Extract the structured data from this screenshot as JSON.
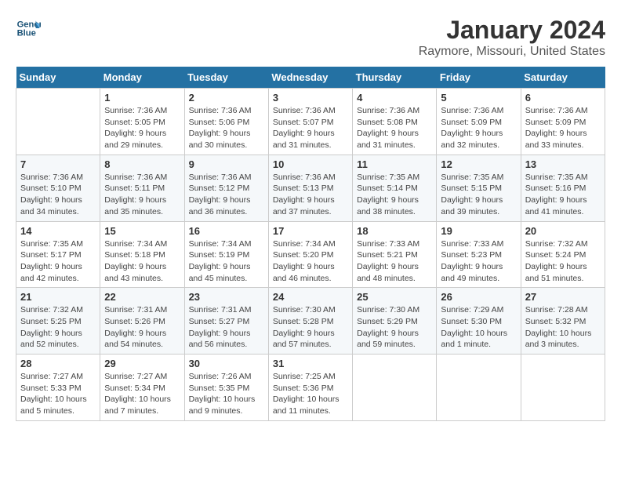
{
  "logo": {
    "line1": "General",
    "line2": "Blue"
  },
  "title": "January 2024",
  "subtitle": "Raymore, Missouri, United States",
  "days_of_week": [
    "Sunday",
    "Monday",
    "Tuesday",
    "Wednesday",
    "Thursday",
    "Friday",
    "Saturday"
  ],
  "weeks": [
    [
      {
        "day": "",
        "info": ""
      },
      {
        "day": "1",
        "info": "Sunrise: 7:36 AM\nSunset: 5:05 PM\nDaylight: 9 hours\nand 29 minutes."
      },
      {
        "day": "2",
        "info": "Sunrise: 7:36 AM\nSunset: 5:06 PM\nDaylight: 9 hours\nand 30 minutes."
      },
      {
        "day": "3",
        "info": "Sunrise: 7:36 AM\nSunset: 5:07 PM\nDaylight: 9 hours\nand 31 minutes."
      },
      {
        "day": "4",
        "info": "Sunrise: 7:36 AM\nSunset: 5:08 PM\nDaylight: 9 hours\nand 31 minutes."
      },
      {
        "day": "5",
        "info": "Sunrise: 7:36 AM\nSunset: 5:09 PM\nDaylight: 9 hours\nand 32 minutes."
      },
      {
        "day": "6",
        "info": "Sunrise: 7:36 AM\nSunset: 5:09 PM\nDaylight: 9 hours\nand 33 minutes."
      }
    ],
    [
      {
        "day": "7",
        "info": "Sunrise: 7:36 AM\nSunset: 5:10 PM\nDaylight: 9 hours\nand 34 minutes."
      },
      {
        "day": "8",
        "info": "Sunrise: 7:36 AM\nSunset: 5:11 PM\nDaylight: 9 hours\nand 35 minutes."
      },
      {
        "day": "9",
        "info": "Sunrise: 7:36 AM\nSunset: 5:12 PM\nDaylight: 9 hours\nand 36 minutes."
      },
      {
        "day": "10",
        "info": "Sunrise: 7:36 AM\nSunset: 5:13 PM\nDaylight: 9 hours\nand 37 minutes."
      },
      {
        "day": "11",
        "info": "Sunrise: 7:35 AM\nSunset: 5:14 PM\nDaylight: 9 hours\nand 38 minutes."
      },
      {
        "day": "12",
        "info": "Sunrise: 7:35 AM\nSunset: 5:15 PM\nDaylight: 9 hours\nand 39 minutes."
      },
      {
        "day": "13",
        "info": "Sunrise: 7:35 AM\nSunset: 5:16 PM\nDaylight: 9 hours\nand 41 minutes."
      }
    ],
    [
      {
        "day": "14",
        "info": "Sunrise: 7:35 AM\nSunset: 5:17 PM\nDaylight: 9 hours\nand 42 minutes."
      },
      {
        "day": "15",
        "info": "Sunrise: 7:34 AM\nSunset: 5:18 PM\nDaylight: 9 hours\nand 43 minutes."
      },
      {
        "day": "16",
        "info": "Sunrise: 7:34 AM\nSunset: 5:19 PM\nDaylight: 9 hours\nand 45 minutes."
      },
      {
        "day": "17",
        "info": "Sunrise: 7:34 AM\nSunset: 5:20 PM\nDaylight: 9 hours\nand 46 minutes."
      },
      {
        "day": "18",
        "info": "Sunrise: 7:33 AM\nSunset: 5:21 PM\nDaylight: 9 hours\nand 48 minutes."
      },
      {
        "day": "19",
        "info": "Sunrise: 7:33 AM\nSunset: 5:23 PM\nDaylight: 9 hours\nand 49 minutes."
      },
      {
        "day": "20",
        "info": "Sunrise: 7:32 AM\nSunset: 5:24 PM\nDaylight: 9 hours\nand 51 minutes."
      }
    ],
    [
      {
        "day": "21",
        "info": "Sunrise: 7:32 AM\nSunset: 5:25 PM\nDaylight: 9 hours\nand 52 minutes."
      },
      {
        "day": "22",
        "info": "Sunrise: 7:31 AM\nSunset: 5:26 PM\nDaylight: 9 hours\nand 54 minutes."
      },
      {
        "day": "23",
        "info": "Sunrise: 7:31 AM\nSunset: 5:27 PM\nDaylight: 9 hours\nand 56 minutes."
      },
      {
        "day": "24",
        "info": "Sunrise: 7:30 AM\nSunset: 5:28 PM\nDaylight: 9 hours\nand 57 minutes."
      },
      {
        "day": "25",
        "info": "Sunrise: 7:30 AM\nSunset: 5:29 PM\nDaylight: 9 hours\nand 59 minutes."
      },
      {
        "day": "26",
        "info": "Sunrise: 7:29 AM\nSunset: 5:30 PM\nDaylight: 10 hours\nand 1 minute."
      },
      {
        "day": "27",
        "info": "Sunrise: 7:28 AM\nSunset: 5:32 PM\nDaylight: 10 hours\nand 3 minutes."
      }
    ],
    [
      {
        "day": "28",
        "info": "Sunrise: 7:27 AM\nSunset: 5:33 PM\nDaylight: 10 hours\nand 5 minutes."
      },
      {
        "day": "29",
        "info": "Sunrise: 7:27 AM\nSunset: 5:34 PM\nDaylight: 10 hours\nand 7 minutes."
      },
      {
        "day": "30",
        "info": "Sunrise: 7:26 AM\nSunset: 5:35 PM\nDaylight: 10 hours\nand 9 minutes."
      },
      {
        "day": "31",
        "info": "Sunrise: 7:25 AM\nSunset: 5:36 PM\nDaylight: 10 hours\nand 11 minutes."
      },
      {
        "day": "",
        "info": ""
      },
      {
        "day": "",
        "info": ""
      },
      {
        "day": "",
        "info": ""
      }
    ]
  ]
}
